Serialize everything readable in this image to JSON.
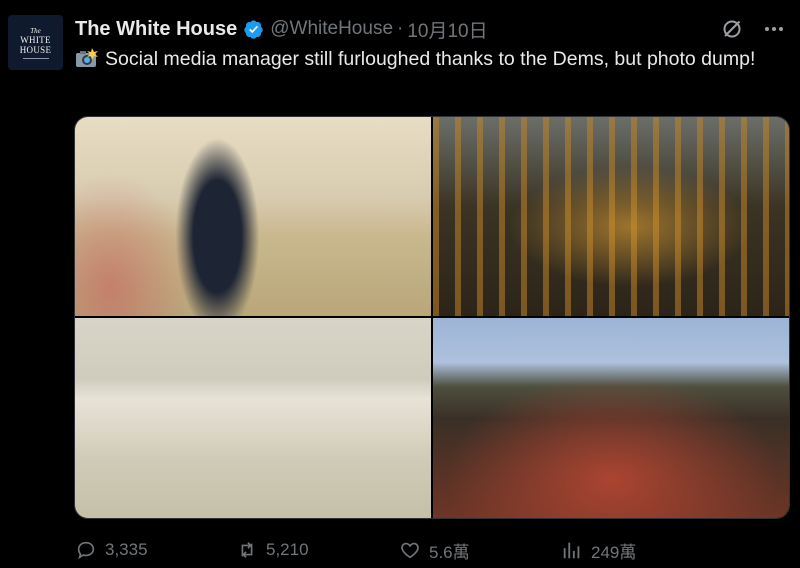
{
  "avatar": {
    "line1": "The",
    "line2": "WHITE",
    "line3": "HOUSE"
  },
  "author": {
    "display_name": "The White House",
    "handle": "@WhiteHouse",
    "separator": "·",
    "date": "10月10日"
  },
  "tweet": {
    "emoji_icon": "camera-flash-icon",
    "text": "Social media manager still furloughed thanks to the Dems, but photo dump!"
  },
  "media": {
    "photo_count": 4
  },
  "actions": {
    "replies": "3,335",
    "reposts": "5,210",
    "likes": "5.6萬",
    "views": "249萬"
  },
  "colors": {
    "background": "#000000",
    "text": "#e7e9ea",
    "muted": "#71767b",
    "verified": "#1d9bf0"
  }
}
